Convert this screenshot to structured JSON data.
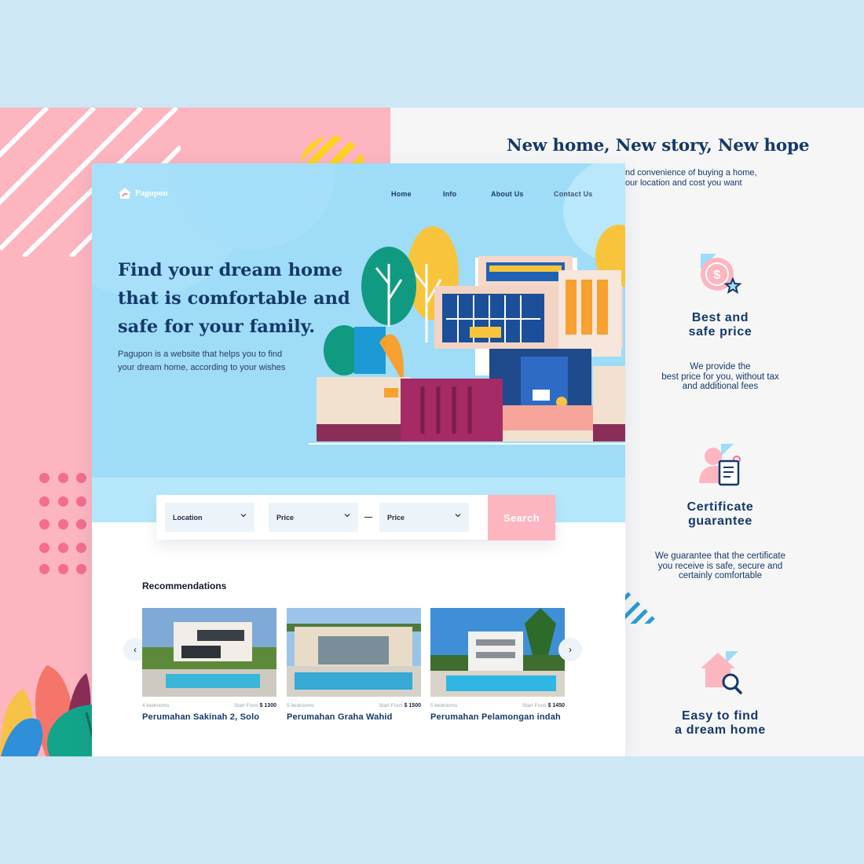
{
  "brand": {
    "name": "Pagupon"
  },
  "nav": {
    "home": "Home",
    "info": "Info",
    "about": "About Us",
    "contact": "Contact Us"
  },
  "hero": {
    "title_l1": "Find your dream home",
    "title_l2": "that is comfortable and",
    "title_l3": "safe for your family.",
    "desc_l1": "Pagupon is a website that helps you to find",
    "desc_l2": "your dream home, according to your wishes"
  },
  "search": {
    "location": "Location",
    "price_min": "Price",
    "price_max": "Price",
    "button": "Search"
  },
  "recommendations": {
    "title": "Recommendations",
    "items": [
      {
        "beds": "4 bedrooms",
        "start": "Start From",
        "price": "$ 1300",
        "name": "Perumahan Sakinah 2, Solo"
      },
      {
        "beds": "5 bedrooms",
        "start": "Start From",
        "price": "$ 1500",
        "name": "Perumahan Graha Wahid"
      },
      {
        "beds": "5 bedrooms",
        "start": "Start From",
        "price": "$ 1450",
        "name": "Perumahan Pelamongan indah"
      }
    ]
  },
  "right": {
    "title": "New home, New story, New hope",
    "sub_l1": "nd convenience of buying a home,",
    "sub_l2": "our location and cost you want",
    "features": [
      {
        "icon": "dollar-coin-icon",
        "t1": "Best and",
        "t2": "safe price",
        "d1": "We provide the",
        "d2": "best price for you, without tax",
        "d3": "and additional fees"
      },
      {
        "icon": "certificate-icon",
        "t1": "Certificate",
        "t2": "guarantee",
        "d1": "We guarantee that the certificate",
        "d2": "you receive is safe, secure and",
        "d3": "certainly comfortable"
      },
      {
        "icon": "house-search-icon",
        "t1": "Easy to find",
        "t2": "a dream home"
      }
    ]
  },
  "colors": {
    "navy": "#15396a",
    "pink": "#fdb5c0",
    "sky": "#9fdcf8",
    "accent_pink": "#f36d8f"
  }
}
